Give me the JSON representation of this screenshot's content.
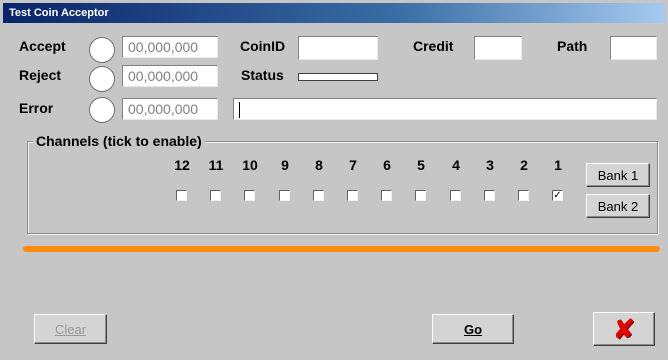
{
  "window": {
    "title": "Test Coin Acceptor"
  },
  "rows": {
    "accept": {
      "label": "Accept",
      "value": "00,000,000"
    },
    "reject": {
      "label": "Reject",
      "value": "00,000,000"
    },
    "error": {
      "label": "Error",
      "value": "00,000,000"
    }
  },
  "fields": {
    "coinid_label": "CoinID",
    "credit_label": "Credit",
    "path_label": "Path",
    "status_label": "Status"
  },
  "channels": {
    "title": "Channels (tick to enable)",
    "numbers": [
      "12",
      "11",
      "10",
      "9",
      "8",
      "7",
      "6",
      "5",
      "4",
      "3",
      "2",
      "1"
    ],
    "checked": [
      false,
      false,
      false,
      false,
      false,
      false,
      false,
      false,
      false,
      false,
      false,
      true
    ],
    "bank1_label": "Bank 1",
    "bank2_label": "Bank 2"
  },
  "buttons": {
    "clear_label": "Clear",
    "go_label": "Go",
    "close_glyph": "✘"
  },
  "colors": {
    "accent_bar": "#ff8c10",
    "close_icon": "#e00000"
  }
}
